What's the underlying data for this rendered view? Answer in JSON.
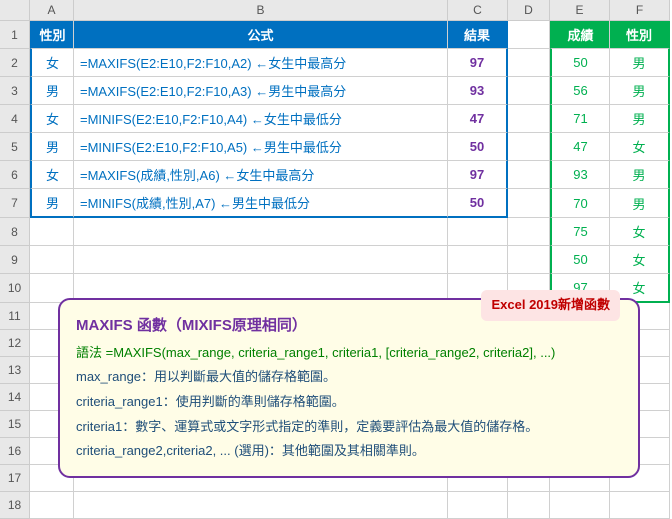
{
  "cols": [
    "A",
    "B",
    "C",
    "D",
    "E",
    "F"
  ],
  "headers": {
    "a": "性別",
    "b": "公式",
    "c": "結果",
    "e": "成績",
    "f": "性別"
  },
  "rows": [
    {
      "a": "女",
      "b": "=MAXIFS(E2:E10,F2:F10,A2) ←女生中最高分",
      "c": "97",
      "e": "50",
      "f": "男"
    },
    {
      "a": "男",
      "b": "=MAXIFS(E2:E10,F2:F10,A3) ←男生中最高分",
      "c": "93",
      "e": "56",
      "f": "男"
    },
    {
      "a": "女",
      "b": "=MINIFS(E2:E10,F2:F10,A4) ←女生中最低分",
      "c": "47",
      "e": "71",
      "f": "男"
    },
    {
      "a": "男",
      "b": "=MINIFS(E2:E10,F2:F10,A5) ←男生中最低分",
      "c": "50",
      "e": "47",
      "f": "女"
    },
    {
      "a": "女",
      "b": "=MAXIFS(成績,性別,A6) ←女生中最高分",
      "c": "97",
      "e": "93",
      "f": "男"
    },
    {
      "a": "男",
      "b": "=MINIFS(成績,性別,A7) ←男生中最低分",
      "c": "50",
      "e": "70",
      "f": "男"
    },
    {
      "a": "",
      "b": "",
      "c": "",
      "e": "75",
      "f": "女"
    },
    {
      "a": "",
      "b": "",
      "c": "",
      "e": "50",
      "f": "女"
    },
    {
      "a": "",
      "b": "",
      "c": "",
      "e": "97",
      "f": "女"
    }
  ],
  "info": {
    "badge": "Excel 2019新增函數",
    "title": "MAXIFS 函數（MIXIFS原理相同）",
    "syntax": "語法 =MAXIFS(max_range, criteria_range1, criteria1, [criteria_range2, criteria2], ...)",
    "l1": "max_range：用以判斷最大值的儲存格範圍。",
    "l2": "criteria_range1：使用判斷的準則儲存格範圍。",
    "l3": "criteria1：數字、運算式或文字形式指定的準則，定義要評估為最大值的儲存格。",
    "l4": "criteria_range2,criteria2, ... (選用)：其他範圍及其相關準則。"
  }
}
